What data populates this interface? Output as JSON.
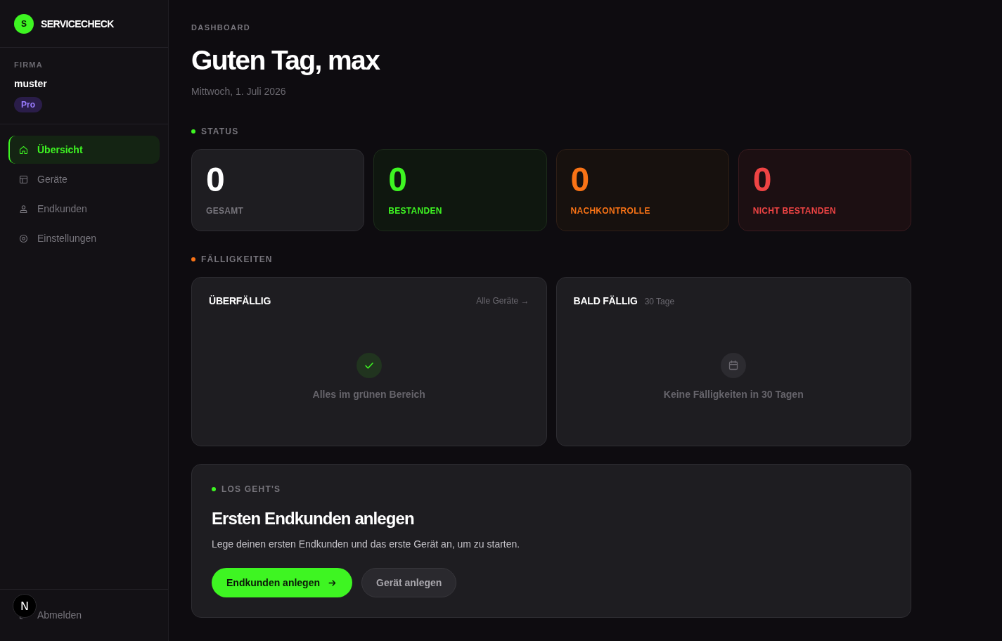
{
  "sidebar": {
    "brand": {
      "logo_letter": "S",
      "name": "SERVICECHECK"
    },
    "company": {
      "label": "FIRMA",
      "name": "muster",
      "plan": "Pro"
    },
    "nav_items": [
      {
        "label": "Übersicht",
        "selected": true
      },
      {
        "label": "Geräte",
        "selected": false
      },
      {
        "label": "Endkunden",
        "selected": false
      },
      {
        "label": "Einstellungen",
        "selected": false
      }
    ],
    "logout": {
      "label": "Abmelden"
    }
  },
  "header": {
    "breadcrumb": "DASHBOARD",
    "title": "Guten Tag, max",
    "date": "Mittwoch, 1. Juli 2026"
  },
  "status": {
    "label": "STATUS",
    "cards": [
      {
        "kind": "neutral",
        "value": "0",
        "label": "GESAMT"
      },
      {
        "kind": "success",
        "value": "0",
        "label": "BESTANDEN"
      },
      {
        "kind": "warning",
        "value": "0",
        "label": "NACHKONTROLLE"
      },
      {
        "kind": "danger",
        "value": "0",
        "label": "NICHT BESTANDEN"
      }
    ]
  },
  "due": {
    "label": "FÄLLIGKEITEN",
    "panels": [
      {
        "title": "ÜBERFÄLLIG",
        "link": "Alle Geräte →",
        "empty_text": "Alles im grünen Bereich"
      },
      {
        "title": "BALD FÄLLIG",
        "note": "30 Tage",
        "empty_text": "Keine Fälligkeiten in 30 Tagen"
      }
    ]
  },
  "getting_started": {
    "label": "LOS GEHT'S",
    "title": "Ersten Endkunden anlegen",
    "text": "Lege deinen ersten Endkunden und das erste Gerät an, um zu starten.",
    "buttons": [
      {
        "kind": "primary",
        "label": "Endkunden anlegen"
      },
      {
        "kind": "secondary",
        "label": "Gerät anlegen"
      }
    ]
  },
  "dev_indicator": {
    "label": "N"
  }
}
